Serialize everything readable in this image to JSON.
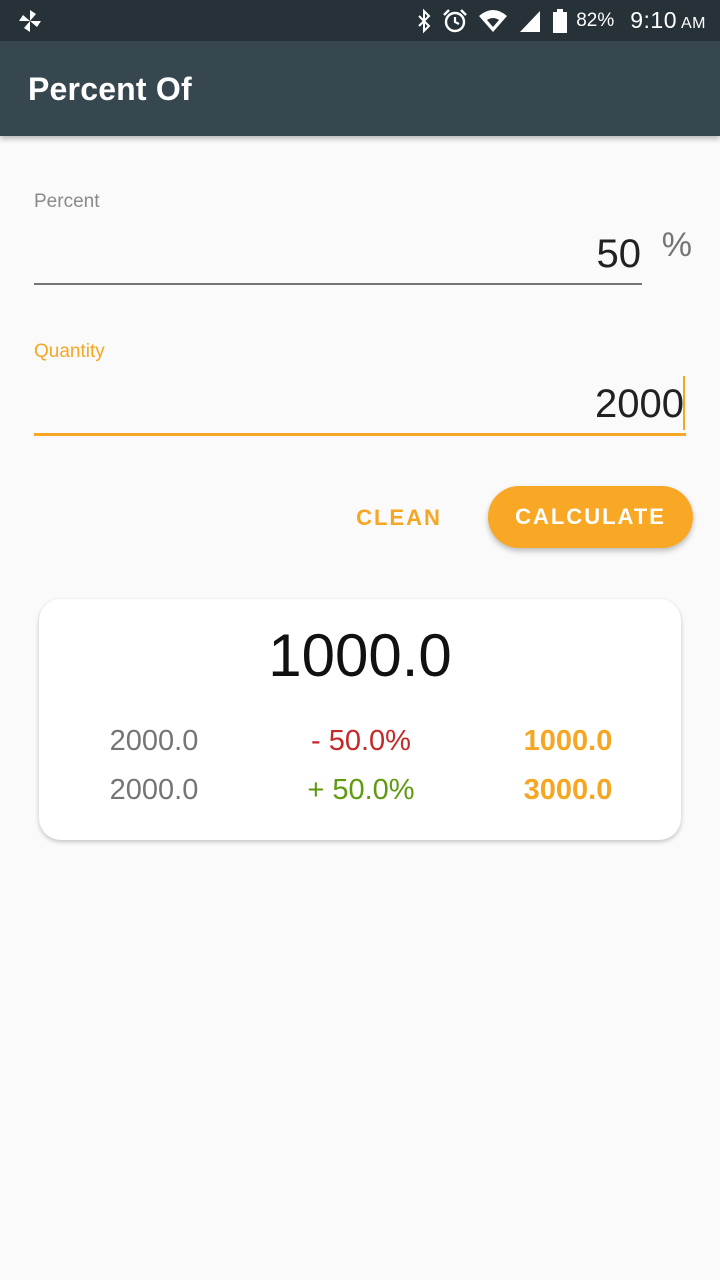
{
  "status_bar": {
    "battery_percent": "82%",
    "time": "9:10",
    "ampm": "AM",
    "icons": [
      "pinwheel-icon",
      "bluetooth-icon",
      "alarm-icon",
      "wifi-icon",
      "cell-signal-icon",
      "battery-icon"
    ]
  },
  "app_bar": {
    "title": "Percent Of"
  },
  "form": {
    "percent": {
      "label": "Percent",
      "value": "50",
      "suffix": "%"
    },
    "quantity": {
      "label": "Quantity",
      "value": "2000"
    }
  },
  "buttons": {
    "clean_label": "CLEAN",
    "calculate_label": "CALCULATE"
  },
  "result": {
    "main_value": "1000.0",
    "rows": [
      {
        "base": "2000.0",
        "change": "- 50.0%",
        "result": "1000.0"
      },
      {
        "base": "2000.0",
        "change": "+ 50.0%",
        "result": "3000.0"
      }
    ]
  },
  "colors": {
    "status_bar": "#263238",
    "app_bar": "#37474f",
    "accent": "#f5a623",
    "button": "#f9a825",
    "negative": "#c62828",
    "positive": "#5f9a0f"
  }
}
